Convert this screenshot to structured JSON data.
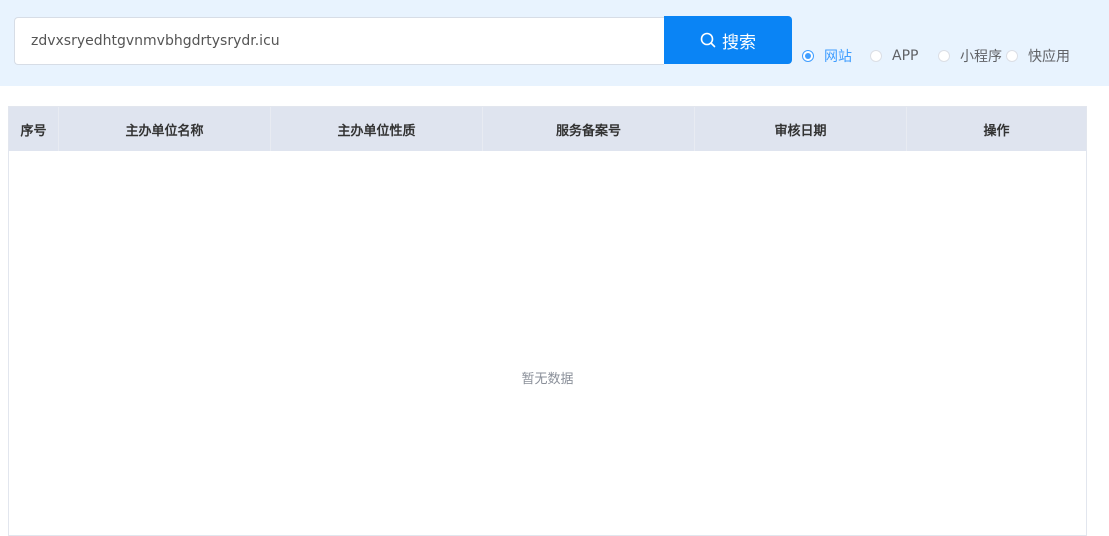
{
  "search": {
    "value": "zdvxsryedhtgvnmvbhgdrtysrydr.icu",
    "button_label": "搜索",
    "icon": "search-icon"
  },
  "types": {
    "options": [
      {
        "label": "网站",
        "checked": true
      },
      {
        "label": "APP",
        "checked": false
      },
      {
        "label": "小程序",
        "checked": false
      },
      {
        "label": "快应用",
        "checked": false
      }
    ]
  },
  "table": {
    "columns": [
      "序号",
      "主办单位名称",
      "主办单位性质",
      "服务备案号",
      "审核日期",
      "操作"
    ],
    "rows": [],
    "empty_text": "暂无数据"
  },
  "colors": {
    "accent": "#0a84f5",
    "radio_active": "#409eff",
    "header_bg": "#e8f3fe",
    "table_header_bg": "#dfe4ef"
  }
}
